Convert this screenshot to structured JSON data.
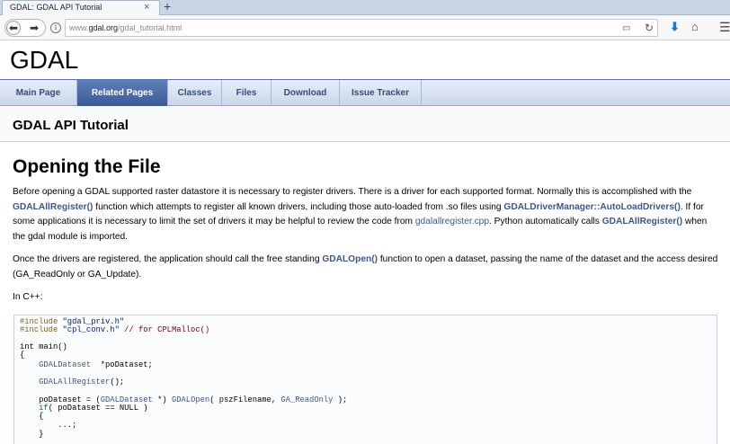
{
  "browser": {
    "tab_title": "GDAL: GDAL API Tutorial",
    "tab_close": "×",
    "new_tab": "+",
    "url_prefix": "www.",
    "url_domain": "gdal.org",
    "url_path": "/gdal_tutorial.html"
  },
  "site": {
    "title": "GDAL"
  },
  "nav_tabs": [
    {
      "label": "Main Page",
      "active": false
    },
    {
      "label": "Related Pages",
      "active": true
    },
    {
      "label": "Classes",
      "active": false
    },
    {
      "label": "Files",
      "active": false
    },
    {
      "label": "Download",
      "active": false
    },
    {
      "label": "Issue Tracker",
      "active": false
    }
  ],
  "page": {
    "heading": "GDAL API Tutorial",
    "section_title": "Opening the File",
    "p1": {
      "t1": "Before opening a GDAL supported raster datastore it is necessary to register drivers. There is a driver for each supported format. Normally this is accomplished with the ",
      "l1": "GDALAllRegister()",
      "t2": " function which attempts to register all known drivers, including those auto-loaded from .so files using ",
      "l2": "GDALDriverManager::AutoLoadDrivers()",
      "t3": ". If for some applications it is necessary to limit the set of drivers it may be helpful to review the code from ",
      "l3": "gdalallregister.cpp",
      "t4": ". Python automatically calls ",
      "l4": "GDALAllRegister()",
      "t5": " when the gdal module is imported."
    },
    "p2": {
      "t1": "Once the drivers are registered, the application should call the free standing ",
      "l1": "GDALOpen()",
      "t2": " function to open a dataset, passing the name of the dataset and the access desired (GA_ReadOnly or GA_Update)."
    },
    "p3": "In C++:"
  },
  "code": {
    "l1_pp": "#include ",
    "l1_str": "\"gdal_priv.h\"",
    "l2_pp": "#include ",
    "l2_str": "\"cpl_conv.h\"",
    "l2_cmt": " // for CPLMalloc()",
    "l3": "int main()",
    "l4": "{",
    "l5_ty": "    GDALDataset",
    "l5_rest": "  *poDataset;",
    "l6_fn": "    GDALAllRegister",
    "l6_rest": "();",
    "l7_a": "    poDataset = (",
    "l7_ty": "GDALDataset",
    "l7_b": " *) ",
    "l7_fn": "GDALOpen",
    "l7_c": "( pszFilename, ",
    "l7_cl": "GA_ReadOnly",
    "l7_d": " );",
    "l8_kw": "    if",
    "l8_rest": "( poDataset == NULL )",
    "l9": "    {",
    "l10": "        ...;",
    "l11": "    }"
  },
  "colors": {
    "link": "#3d578c",
    "tab_active_bg": "#3d5a98",
    "tab_text": "#364d7c",
    "code_bg": "#fbfcfd"
  }
}
